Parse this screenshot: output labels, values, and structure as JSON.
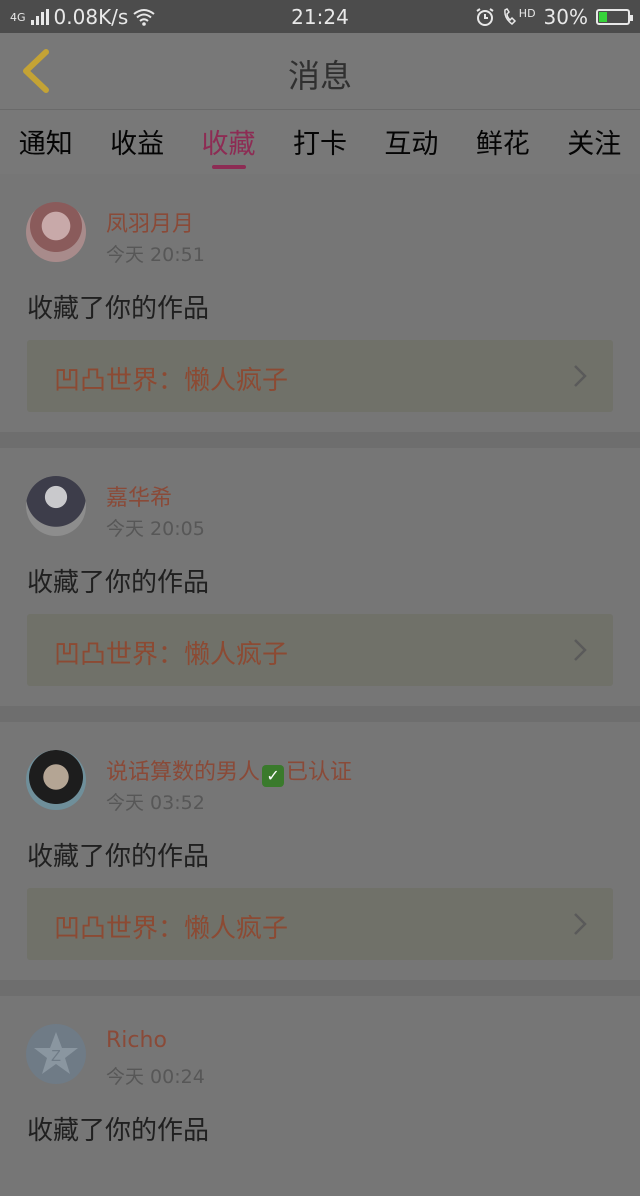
{
  "status_bar": {
    "network_type": "4G",
    "speed": "0.08K/s",
    "time": "21:24",
    "hd_label": "HD",
    "battery": "30%",
    "battery_level": 0.3
  },
  "header": {
    "title": "消息"
  },
  "tabs": [
    {
      "label": "通知",
      "active": false
    },
    {
      "label": "收益",
      "active": false
    },
    {
      "label": "收藏",
      "active": true
    },
    {
      "label": "打卡",
      "active": false
    },
    {
      "label": "互动",
      "active": false
    },
    {
      "label": "鲜花",
      "active": false
    },
    {
      "label": "关注",
      "active": false
    }
  ],
  "messages": [
    {
      "user": "凤羽月月",
      "time": "今天 20:51",
      "action": "收藏了你的作品",
      "work": "凹凸世界：懒人疯子"
    },
    {
      "user": "嘉华希",
      "time": "今天 20:05",
      "action": "收藏了你的作品",
      "work": "凹凸世界：懒人疯子"
    },
    {
      "user": "说话算数的男人",
      "verified_text": "已认证",
      "time": "今天 03:52",
      "action": "收藏了你的作品",
      "work": "凹凸世界：懒人疯子"
    },
    {
      "user": "Richo",
      "time": "今天 00:24",
      "action": "收藏了你的作品"
    }
  ],
  "colors": {
    "accent": "#8d2c54",
    "username": "#8a4a38",
    "work_title": "#8c4a33"
  },
  "icons": {
    "back": "chevron-left-icon",
    "work_link": "chevron-right-icon"
  }
}
